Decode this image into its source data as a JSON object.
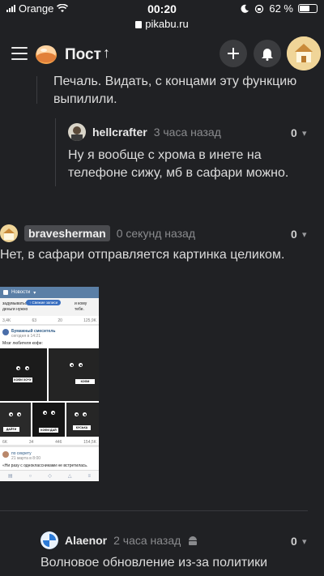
{
  "status_bar": {
    "carrier": "Orange",
    "time": "00:20",
    "battery_text": "62 %",
    "battery_level": 0.62,
    "url": "pikabu.ru"
  },
  "header": {
    "title": "Пост"
  },
  "comments": [
    {
      "text": "Печаль. Видать, с концами эту функцию выпилили."
    },
    {
      "username": "hellcrafter",
      "time": "3 часа назад",
      "score": "0",
      "text": "Ну я вообще с хрома в инете на телефоне сижу, мб в сафари можно."
    },
    {
      "username": "bravesherman",
      "time": "0 секунд назад",
      "score": "0",
      "text": "Нет, в сафари отправляется картинка целиком."
    },
    {
      "username": "Alaenor",
      "time": "2 часа назад",
      "score": "0",
      "text": "Волновое обновление из-за политики"
    }
  ],
  "embedded_screenshot": {
    "header_title": "Новости",
    "pill": "Свежие записи",
    "snippet_line1": "задумываться о",
    "snippet_line2": "деньги нужно",
    "snippet_right1": "и кому",
    "snippet_right2": "тебе.",
    "stats1": [
      "3,4K",
      "63",
      "20",
      "125,9K"
    ],
    "group_name": "Бумажный смеситель",
    "group_time": "сегодня в 14:21",
    "post_text": "Мозг любителя кофе:",
    "sign_1": "КОФИ ХОЧУ",
    "sign_2": "КОФИ",
    "sign_3": "ДАЙТИ",
    "sign_4": "КОФИ ДАЙ",
    "sign_5": "КУСЬКА",
    "stats2": [
      "6K",
      "34",
      "446",
      "154,5K"
    ],
    "post2_name": "по секрету",
    "post2_time": "21 марта в 8:00",
    "post2_text": "«Ни разу с одноклассниками не встретилась."
  }
}
